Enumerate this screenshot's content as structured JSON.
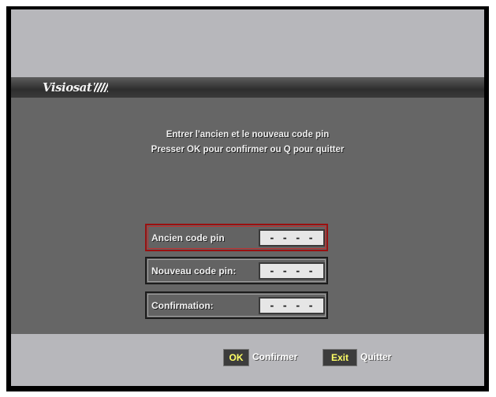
{
  "brand": {
    "name": "Visiosat"
  },
  "message": {
    "line1": "Entrer l'ancien et le nouveau code pin",
    "line2": "Presser OK pour confirmer ou Q pour quitter"
  },
  "pin_fields": [
    {
      "label": "Ancien code pin",
      "value": "- - - -",
      "selected": true
    },
    {
      "label": "Nouveau code pin:",
      "value": "- - - -",
      "selected": false
    },
    {
      "label": "Confirmation:",
      "value": "- - - -",
      "selected": false
    }
  ],
  "footer": {
    "ok_key": "OK",
    "ok_label": "Confirmer",
    "exit_key": "Exit",
    "exit_label": "Quitter"
  },
  "colors": {
    "panel_light": "#b7b7bb",
    "panel_dark": "#666666",
    "selection_border": "#9a1010",
    "key_text": "#ffff66"
  }
}
